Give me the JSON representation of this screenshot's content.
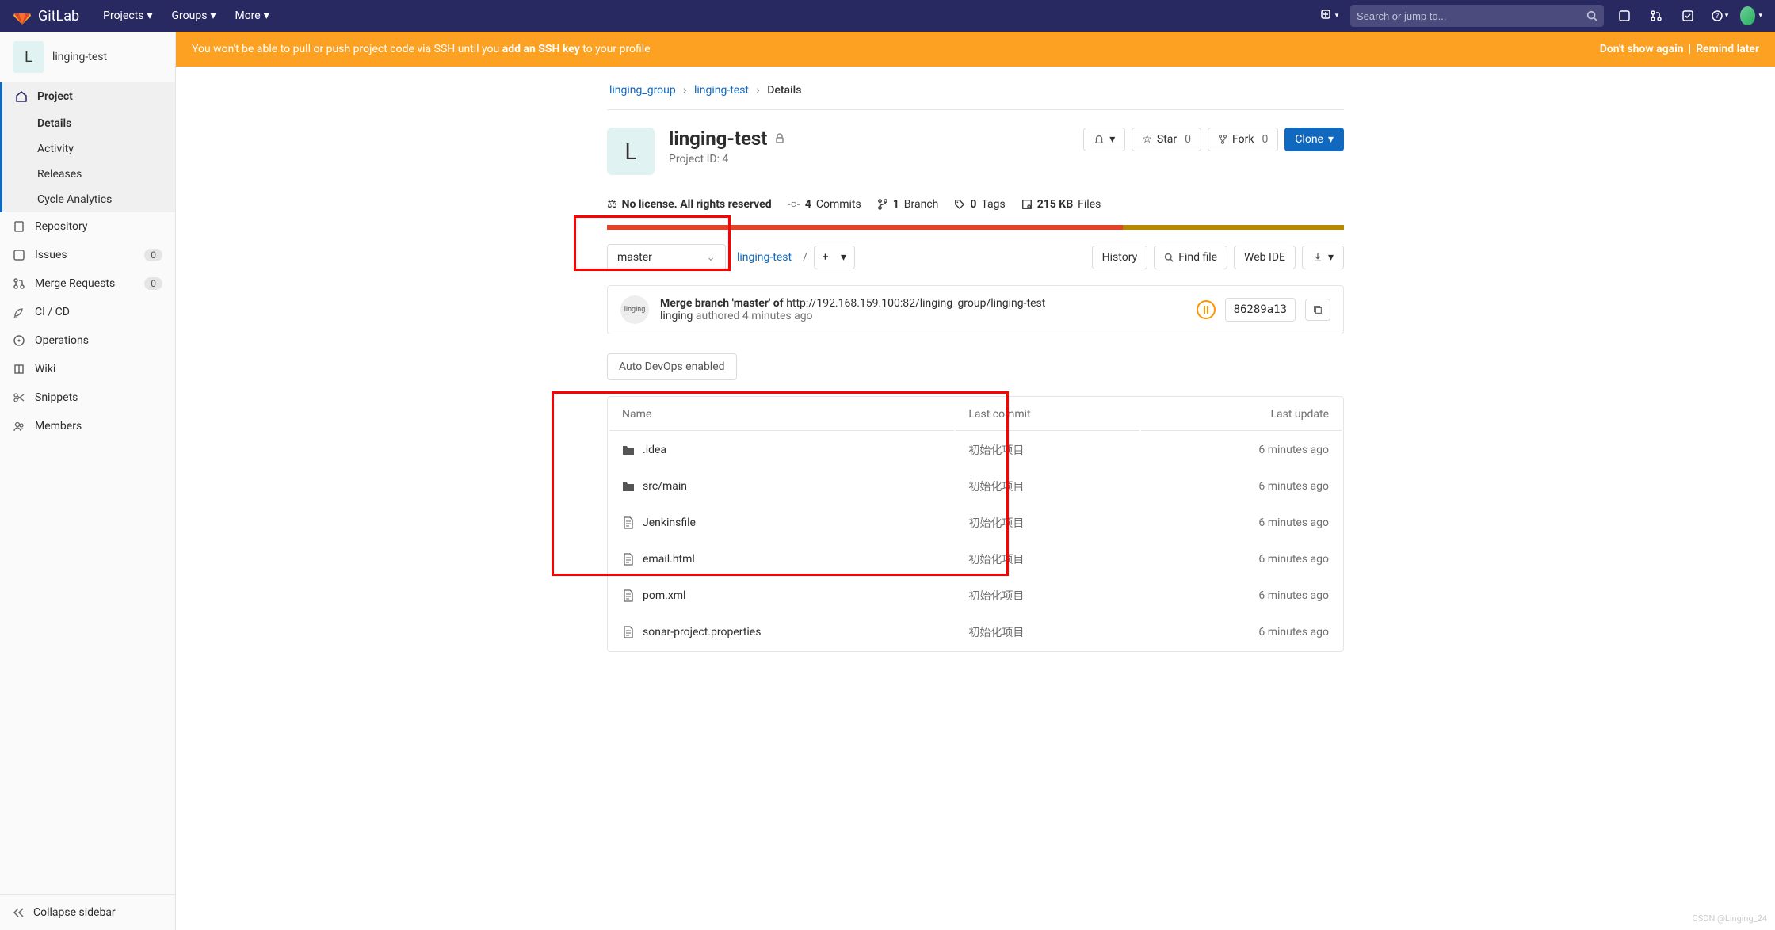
{
  "brand": "GitLab",
  "nav": {
    "projects": "Projects",
    "groups": "Groups",
    "more": "More"
  },
  "search": {
    "placeholder": "Search or jump to..."
  },
  "banner": {
    "text_before": "You won't be able to pull or push project code via SSH until you ",
    "link": "add an SSH key",
    "text_after": " to your profile",
    "dont_show": "Don't show again",
    "sep": " | ",
    "remind": "Remind later"
  },
  "sidebar": {
    "project_letter": "L",
    "project_name": "linging-test",
    "sections": {
      "project": "Project",
      "sub": {
        "details": "Details",
        "activity": "Activity",
        "releases": "Releases",
        "cycle": "Cycle Analytics"
      },
      "repository": "Repository",
      "issues": "Issues",
      "issues_count": "0",
      "mr": "Merge Requests",
      "mr_count": "0",
      "cicd": "CI / CD",
      "ops": "Operations",
      "wiki": "Wiki",
      "snippets": "Snippets",
      "members": "Members"
    },
    "collapse": "Collapse sidebar"
  },
  "breadcrumbs": {
    "group": "linging_group",
    "project": "linging-test",
    "current": "Details"
  },
  "project": {
    "letter": "L",
    "name": "linging-test",
    "id_label": "Project ID: 4",
    "bell": "",
    "star": "Star",
    "star_count": "0",
    "fork": "Fork",
    "fork_count": "0",
    "clone": "Clone"
  },
  "stats": {
    "license": "No license. All rights reserved",
    "commits_n": "4",
    "commits_label": " Commits",
    "branch_n": "1",
    "branch_label": " Branch",
    "tags_n": "0",
    "tags_label": " Tags",
    "files_n": "215 KB",
    "files_label": " Files"
  },
  "toolbar": {
    "branch": "master",
    "path": "linging-test",
    "history": "History",
    "find": "Find file",
    "webide": "Web IDE"
  },
  "commit": {
    "title_prefix": "Merge branch 'master' of ",
    "title_url": "http://192.168.159.100:82/linging_group/linging-test",
    "author": "linging",
    "authored": " authored ",
    "time": "4 minutes ago",
    "sha": "86289a13",
    "avatar_alt": "linging"
  },
  "devops": "Auto DevOps enabled",
  "table": {
    "headers": {
      "name": "Name",
      "commit": "Last commit",
      "update": "Last update"
    },
    "rows": [
      {
        "icon": "folder",
        "name": ".idea",
        "msg": "初始化项目",
        "time": "6 minutes ago"
      },
      {
        "icon": "folder",
        "name": "src/main",
        "msg": "初始化项目",
        "time": "6 minutes ago"
      },
      {
        "icon": "file",
        "name": "Jenkinsfile",
        "msg": "初始化项目",
        "time": "6 minutes ago"
      },
      {
        "icon": "file",
        "name": "email.html",
        "msg": "初始化项目",
        "time": "6 minutes ago"
      },
      {
        "icon": "file",
        "name": "pom.xml",
        "msg": "初始化项目",
        "time": "6 minutes ago"
      },
      {
        "icon": "file",
        "name": "sonar-project.properties",
        "msg": "初始化项目",
        "time": "6 minutes ago"
      }
    ]
  },
  "watermark": "CSDN @Linging_24"
}
